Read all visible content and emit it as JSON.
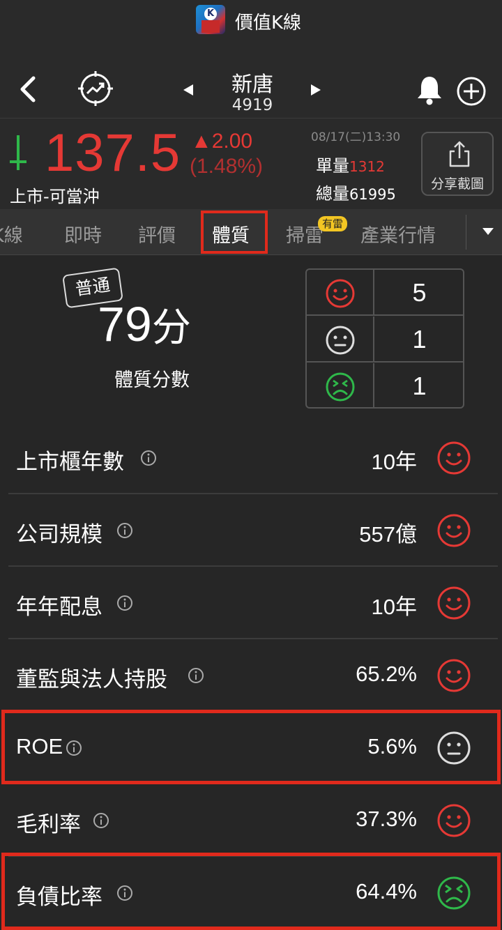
{
  "app": {
    "title": "價值K線"
  },
  "nav": {
    "stock_name": "新唐",
    "stock_code": "4919"
  },
  "quote": {
    "price": "137.5",
    "change": "▲2.00",
    "change_pct": "(1.48%)",
    "market": "上市-可當沖",
    "time": "08/17(二)13:30",
    "unit_volume_label": "單量",
    "unit_volume": "1312",
    "total_volume_label": "總量",
    "total_volume": "61995",
    "share_label": "分享截圖",
    "price_color": "#e53935"
  },
  "tabs": [
    {
      "label": "K線"
    },
    {
      "label": "即時"
    },
    {
      "label": "評價"
    },
    {
      "label": "體質",
      "active": true
    },
    {
      "label": "掃雷",
      "badge": "有雷"
    },
    {
      "label": "產業行情"
    }
  ],
  "score": {
    "grade": "普通",
    "value": "79",
    "unit": "分",
    "label": "體質分數",
    "summary": [
      {
        "icon": "smile-face-icon",
        "count": "5",
        "color": "#e53935"
      },
      {
        "icon": "neutral-face-icon",
        "count": "1",
        "color": "#dddddd"
      },
      {
        "icon": "frown-face-icon",
        "count": "1",
        "color": "#2fb84a"
      }
    ]
  },
  "metrics": [
    {
      "label": "上市櫃年數",
      "value_num": "10",
      "value_unit": "年",
      "rating": "good"
    },
    {
      "label": "公司規模",
      "value_num": "557",
      "value_unit": "億",
      "rating": "good"
    },
    {
      "label": "年年配息",
      "value_num": "10",
      "value_unit": "年",
      "rating": "good"
    },
    {
      "label": "董監與法人持股",
      "value_num": "65.2%",
      "value_unit": "",
      "rating": "good"
    },
    {
      "label": "ROE",
      "value_num": "5.6%",
      "value_unit": "",
      "rating": "neutral"
    },
    {
      "label": "毛利率",
      "value_num": "37.3%",
      "value_unit": "",
      "rating": "good"
    },
    {
      "label": "負債比率",
      "value_num": "64.4%",
      "value_unit": "",
      "rating": "bad"
    }
  ],
  "colors": {
    "good": "#e53935",
    "neutral": "#dddddd",
    "bad": "#2fb84a",
    "highlight": "#e02a1c"
  }
}
